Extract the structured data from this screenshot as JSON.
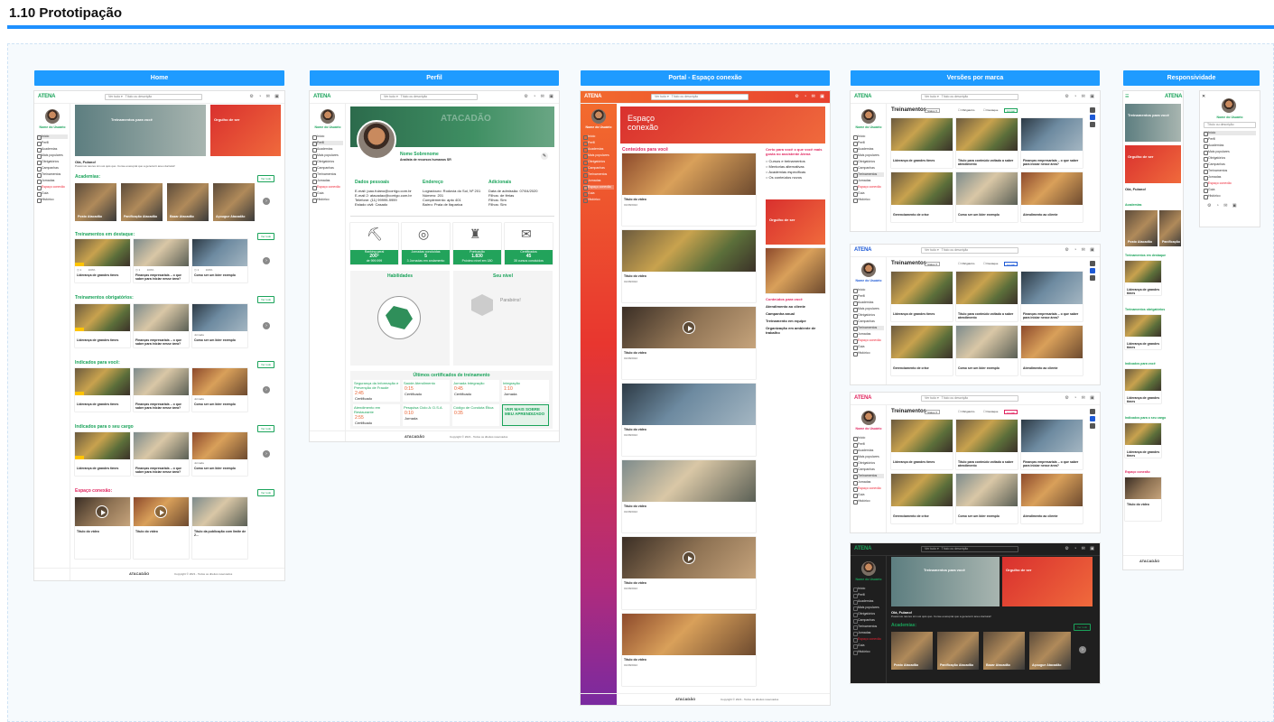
{
  "page_title": "1.10 Prototipação",
  "frames": {
    "home": "Home",
    "perfil": "Perfil",
    "portal": "Portal - Espaço conexão",
    "versoes": "Versões por marca",
    "responsividade": "Responsividade"
  },
  "common": {
    "logo": "ATENA",
    "search_scope": "Ver tudo",
    "search_placeholder": "Título ou descrição",
    "user_name": "Nome do Usuário",
    "see_all": "Ver tudo",
    "footer_logo": "ATACADÃO",
    "copyright": "Copyright © 2021 - Todos os direitos reservados"
  },
  "sidebar_items": [
    "Início",
    "Perfil",
    "Academias",
    "Mais populares",
    "Obrigatórios",
    "Campanhas",
    "Treinamentos",
    "Jornadas",
    "Espaço conexão",
    "Guia",
    "Histórico"
  ],
  "home": {
    "banner1": "Treinamentos para você",
    "banner2": "Orgulho de ser",
    "greeting": "Olá, Fulano!",
    "greeting_sub": "Possimus reiores sim usi quis quo. Conse exereprat quo a generat ti aneu ducturat!",
    "academias_title": "Academias:",
    "academias": [
      "Posto Atacadão",
      "Panificação Atacadão",
      "Bazar Atacadão",
      "Açougue Atacadão"
    ],
    "sections": [
      "Treinamentos em destaque:",
      "Treinamentos obrigatórios:",
      "Indicados para você:",
      "Indicados para o seu cargo",
      "Espaço conexão:"
    ],
    "card_titles": [
      "Liderança de grandes times",
      "Finanças empresariais – o que saber para iniciar nesse área?",
      "Como ser um líder exemplo"
    ],
    "video_titles": [
      "Título do vídeo",
      "Título do vídeo",
      "Título da publicação com limite de 2..."
    ],
    "card_meta": "100%",
    "jornada": "Jornada"
  },
  "perfil": {
    "name": "Nome Sobrenome",
    "role": "Analista de recursos humanos SR",
    "banner_text": "ATACADÃO",
    "col1_title": "Dados pessoais",
    "col2_title": "Endereço",
    "col3_title": "Adicionais",
    "col1": [
      "E-mail: joao.fulano@corrigo.com.br",
      "E-mail 2: atacadao@corrigo.com.br",
      "Telefone: (11) 99999-9999",
      "Estado civil: Casado"
    ],
    "col2": [
      "Logradouro: Rodovia do Sol, Nº 201",
      "Número: 201",
      "Complemento: apto 401",
      "Bairro: Praia de Itaparica"
    ],
    "col3": [
      "Data de admissão: 07/04/2020",
      "Filhos: de férias",
      "Filhos: Sim",
      "Filhos: Sim"
    ],
    "stats": [
      {
        "label": "Ranking geral",
        "value": "200º",
        "sub": "de 999.999"
      },
      {
        "label": "Jornadas concluídas",
        "value": "5",
        "sub": "3 Jornadas em andamento"
      },
      {
        "label": "Pontuação",
        "value": "1.830",
        "sub": "Próximo nível em 180"
      },
      {
        "label": "Certificados",
        "value": "45",
        "sub": "35 cursos concluídos"
      }
    ],
    "habilidades_title": "Habilidades",
    "nivel_title": "Seu nível",
    "nivel_name": "Parabéns!",
    "ultimos_title": "Últimos certificados de treinamento",
    "certs": [
      {
        "name": "Segurança da Informação e Prevenção de Fraude",
        "value": "2:45",
        "sub": "Certificado"
      },
      {
        "name": "Saúde Atendimento",
        "value": "0:15",
        "sub": "Certificado"
      },
      {
        "name": "Jornada Integração",
        "value": "0:45",
        "sub": "Certificado"
      },
      {
        "name": "Integração",
        "value": "1:10",
        "sub": "Jornada"
      },
      {
        "name": "Atendimento em Restaurante",
        "value": "2:55",
        "sub": "Certificado"
      },
      {
        "name": "Pesquisa Ciclo A: D.S.A",
        "value": "0:10",
        "sub": "Jornada"
      },
      {
        "name": "Código de Conduta Ética",
        "value": "0:35",
        "sub": "Certificado"
      }
    ],
    "see_more": "VER MAIS SOBRE MEU APRENDIZADO"
  },
  "portal": {
    "banner_title": "Espaço conexão",
    "feed_title": "Conteúdos para você",
    "poll_title": "Certo para você o que você mais gosta no assistente Atena",
    "poll_options": [
      "Cursos e treinamentos",
      "Mentorias alternativas",
      "Academias específicas",
      "Os conteúdos novos"
    ],
    "side_card_title": "Orgulho de ser",
    "side_list_title": "Conteúdos para você",
    "side_list": [
      "Atendimento ao cliente",
      "Campanha anual",
      "Treinamento em equipe",
      "Organização em ambiente de trabalho"
    ],
    "post_title": "Título do vídeo",
    "post_date": "01/08/2022",
    "post_tag": "Nome do autor"
  },
  "versoes": {
    "heading": "Treinamentos",
    "filter": "Status",
    "opt1": "Obrigatório",
    "opt2": "Destaque",
    "clear": "Limpar",
    "cards": [
      "Liderança de grandes times",
      "Título para conteúdo voltado a saber atendimento",
      "Finanças empresariais – o que saber para iniciar nesse área?",
      "Gerenciamento de crise",
      "Como ser um líder exemplo",
      "Atendimento ao cliente"
    ],
    "dark_greeting": "Olá, Fulano!",
    "dark_sub": "Possimus reiores sim usi quis quo. Conse exereprat quo a generat ti aneu ducturat!",
    "dark_academias": "Academias:",
    "dark_acad": [
      "Posto Atacadão",
      "Panificação Atacadão",
      "Bazar Atacadão",
      "Açougue Atacadão"
    ],
    "dark_banner1": "Treinamentos para você",
    "dark_banner2": "Orgulho de ser"
  },
  "resp": {
    "banner": "Treinamentos para você",
    "banner2": "Orgulho de ser",
    "greeting": "Olá, Fulano!",
    "sections": [
      "Academias",
      "Treinamentos em destaque",
      "Treinamentos obrigatórios",
      "Indicados para você",
      "Indicados para o seu cargo",
      "Espaço conexão"
    ],
    "menu_items": [
      "Título ou descrição",
      "Início",
      "Perfil",
      "Academias",
      "Mais populares",
      "Obrigatórios",
      "Campanhas",
      "Treinamentos",
      "Jornadas",
      "Espaço conexão",
      "Guia",
      "Histórico"
    ],
    "acad": [
      "Posto Atacadão",
      "Panificação"
    ],
    "card_title": "Liderança de grandes times",
    "video_title": "Título do vídeo"
  }
}
